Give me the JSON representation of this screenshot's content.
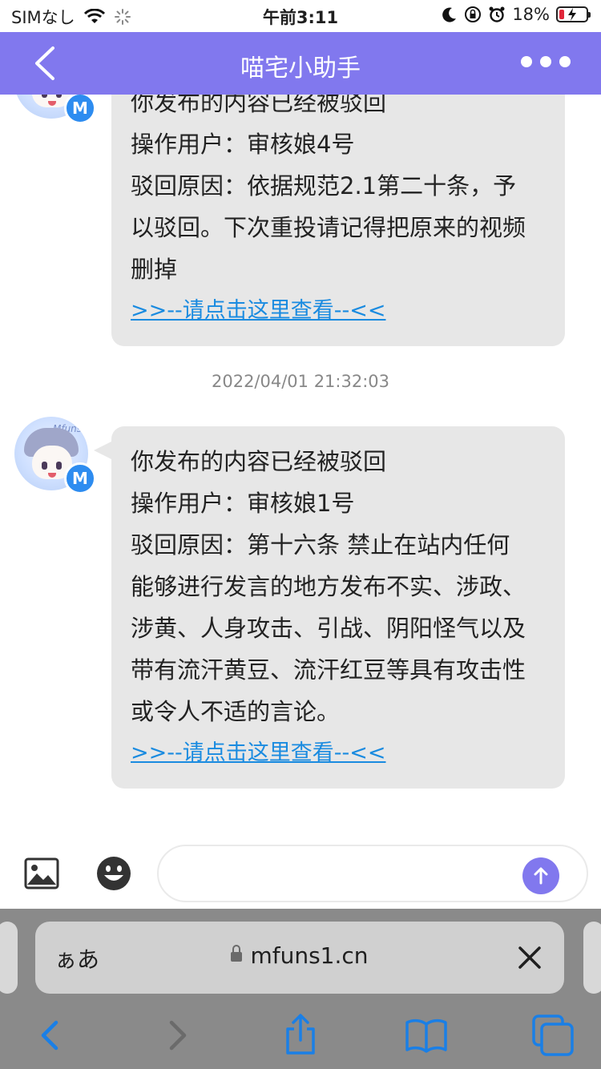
{
  "status_bar": {
    "carrier": "SIMなし",
    "time": "午前3:11",
    "battery_text": "18%",
    "battery_level": 0.18
  },
  "header": {
    "title": "喵宅小助手"
  },
  "messages": [
    {
      "lines": [
        "你发布的内容已经被驳回",
        "操作用户：审核娘4号",
        "驳回原因：依据规范2.1第二十条，予",
        "以驳回。下次重投请记得把原来的视频",
        "删掉"
      ],
      "link": ">>--请点击这里查看--<<"
    },
    {
      "lines": [
        "你发布的内容已经被驳回",
        "操作用户：审核娘1号",
        "驳回原因：第十六条 禁止在站内任何",
        "能够进行发言的地方发布不实、涉政、",
        "涉黄、人身攻击、引战、阴阳怪气以及",
        "带有流汗黄豆、流汗红豆等具有攻击性",
        "或令人不适的言论。"
      ],
      "link": ">>--请点击这里查看--<<"
    }
  ],
  "timestamp": "2022/04/01 21:32:03",
  "avatar": {
    "label": "Mfuns",
    "badge": "M"
  },
  "input": {
    "placeholder": ""
  },
  "safari": {
    "aa": "ぁあ",
    "url": "mfuns1.cn"
  },
  "colors": {
    "header": "#8178ee",
    "link": "#1a8be0",
    "bubble": "#e7e7e7",
    "safari_blue": "#1a7fe6"
  },
  "icons": [
    "wifi-icon",
    "loading-icon",
    "moon-icon",
    "orientation-lock-icon",
    "alarm-icon",
    "battery-icon",
    "back-chevron-icon",
    "more-dots-icon",
    "image-icon",
    "emoji-icon",
    "send-arrow-icon",
    "lock-icon",
    "close-icon",
    "safari-back-icon",
    "safari-forward-icon",
    "share-icon",
    "bookmarks-icon",
    "tabs-icon"
  ]
}
